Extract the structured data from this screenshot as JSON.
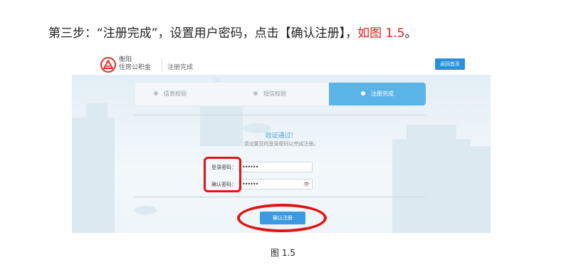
{
  "instruction": {
    "text": "第三步：“注册完成”，设置用户密码，点击【确认注册】，",
    "figure_ref": "如图 1.5",
    "end": "。"
  },
  "screenshot": {
    "logo_line1": "衡阳",
    "logo_line2": "住房公积金",
    "breadcrumb": "注册完成",
    "home_button": "返回首页",
    "steps": [
      {
        "label": "信息校验",
        "state": "done"
      },
      {
        "label": "短信校验",
        "state": "done"
      },
      {
        "label": "注册完成",
        "state": "active"
      }
    ],
    "success_title": "验证通过！",
    "success_subtitle": "请设置您的登录密码以完成注册。",
    "fields": [
      {
        "label": "登录密码：",
        "value": "••••••"
      },
      {
        "label": "确认密码：",
        "value": "••••••"
      }
    ],
    "submit_button": "确认注册",
    "accent_color": "#5bb4e8",
    "highlight_color": "#e01414"
  },
  "caption": "图 1.5"
}
